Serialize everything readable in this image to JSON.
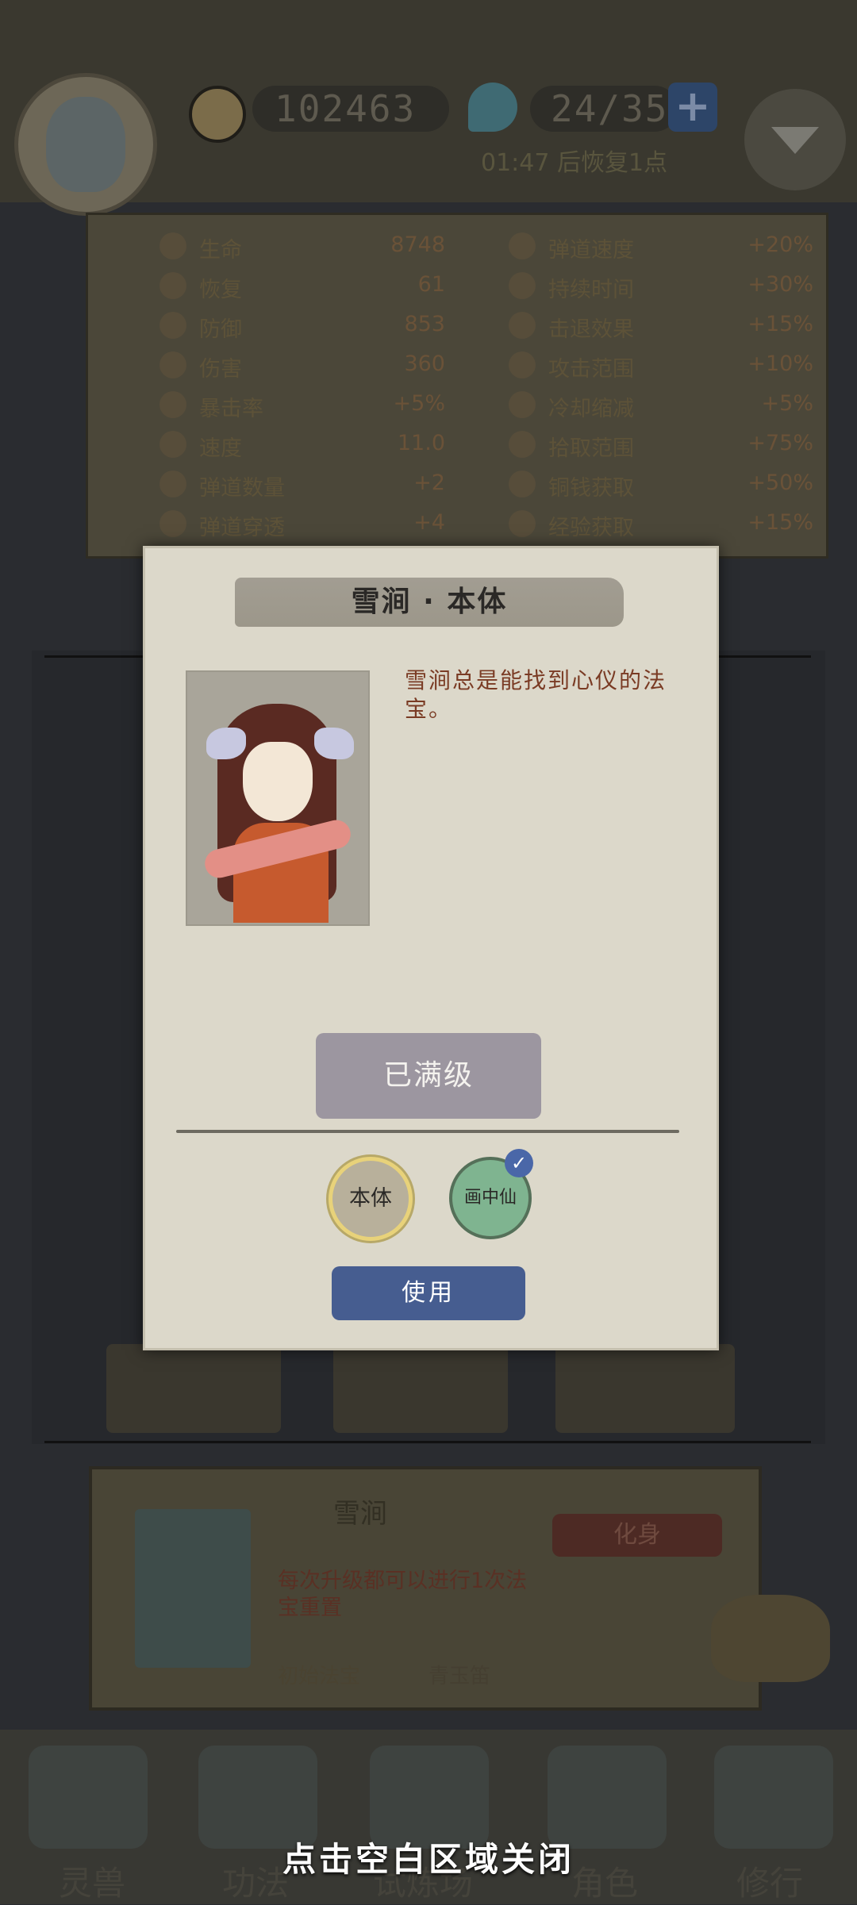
{
  "topbar": {
    "coins": "102463",
    "energy": "24/35",
    "recover_text": "01:47 后恢复1点",
    "icons": {
      "coin": "coin-icon",
      "energy": "jade-icon",
      "add": "plus-icon",
      "menu": "chevron-down-icon"
    }
  },
  "stats": {
    "left": [
      {
        "label": "生命",
        "value": "8748"
      },
      {
        "label": "恢复",
        "value": "61"
      },
      {
        "label": "防御",
        "value": "853"
      },
      {
        "label": "伤害",
        "value": "360"
      },
      {
        "label": "暴击率",
        "value": "+5%"
      },
      {
        "label": "速度",
        "value": "11.0"
      },
      {
        "label": "弹道数量",
        "value": "+2"
      },
      {
        "label": "弹道穿透",
        "value": "+4"
      }
    ],
    "right": [
      {
        "label": "弹道速度",
        "value": "+20%"
      },
      {
        "label": "持续时间",
        "value": "+30%"
      },
      {
        "label": "击退效果",
        "value": "+15%"
      },
      {
        "label": "攻击范围",
        "value": "+10%"
      },
      {
        "label": "冷却缩减",
        "value": "+5%"
      },
      {
        "label": "拾取范围",
        "value": "+75%"
      },
      {
        "label": "铜钱获取",
        "value": "+50%"
      },
      {
        "label": "经验获取",
        "value": "+15%"
      }
    ]
  },
  "hero": {
    "name": "雪涧",
    "transform_label": "化身",
    "desc": "每次升级都可以进行1次法宝重置",
    "initial_label": "初始法宝",
    "initial_weapon": "青玉笛"
  },
  "nav": [
    "灵兽",
    "功法",
    "试炼场",
    "角色",
    "修行"
  ],
  "modal": {
    "title": "雪涧 · 本体",
    "description": "雪涧总是能找到心仪的法宝。",
    "maxed_label": "已满级",
    "skins": [
      {
        "label": "本体",
        "selected": true
      },
      {
        "label": "画中仙",
        "owned": true
      }
    ],
    "check_mark": "✓",
    "use_label": "使用"
  },
  "close_hint": "点击空白区域关闭",
  "colors": {
    "modal_bg": "#dcd8ca",
    "use_button": "#465d90",
    "maxed_button": "#9c96a0",
    "desc_text": "#7a3b24"
  }
}
